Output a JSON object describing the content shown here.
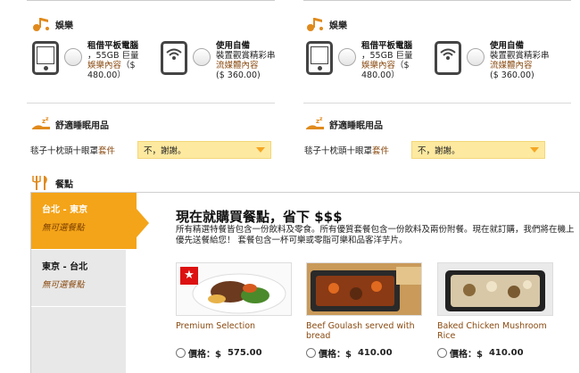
{
  "entertainment": {
    "title": "娛樂",
    "options": [
      {
        "title": "租借平板電腦",
        "desc1": "，55GB 巨量",
        "desc2": "娛樂內容",
        "price": "（$ 480.00）"
      },
      {
        "title": "使用自備",
        "desc1": "裝置觀賞精彩串",
        "desc2": "流媒體內容",
        "price": "($ 360.00)"
      }
    ]
  },
  "comfort": {
    "title": "舒適睡眠用品",
    "label_main": "毯子十枕頭十眼罩",
    "label_suffix": "套件",
    "select_value": "不，謝謝。"
  },
  "meals": {
    "title": "餐點",
    "tabs": [
      {
        "route": "台北 - 東京",
        "sub": "無可選餐點"
      },
      {
        "route": "東京 - 台北",
        "sub": "無可選餐點"
      }
    ],
    "promo_title": "現在就購買餐點，省下 $$$",
    "promo_desc": "所有精選特餐皆包含一份飲料及零食。所有優質套餐包含一份飲料及兩份附餐。現在就訂購，我們將在機上優先送餐給您！ 套餐包含一杯可樂或零脂可樂和品客洋芋片。",
    "items": [
      {
        "name": "Premium Selection",
        "price_label": "價格：$",
        "price": "575.00"
      },
      {
        "name": "Beef Goulash served with bread",
        "price_label": "價格：$",
        "price": "410.00"
      },
      {
        "name": "Baked Chicken Mushroom Rice",
        "price_label": "價格：$",
        "price": "410.00"
      }
    ]
  },
  "colors": {
    "accent": "#f4a418",
    "brown_text": "#8a4b12",
    "select_bg": "#fde9a0"
  }
}
